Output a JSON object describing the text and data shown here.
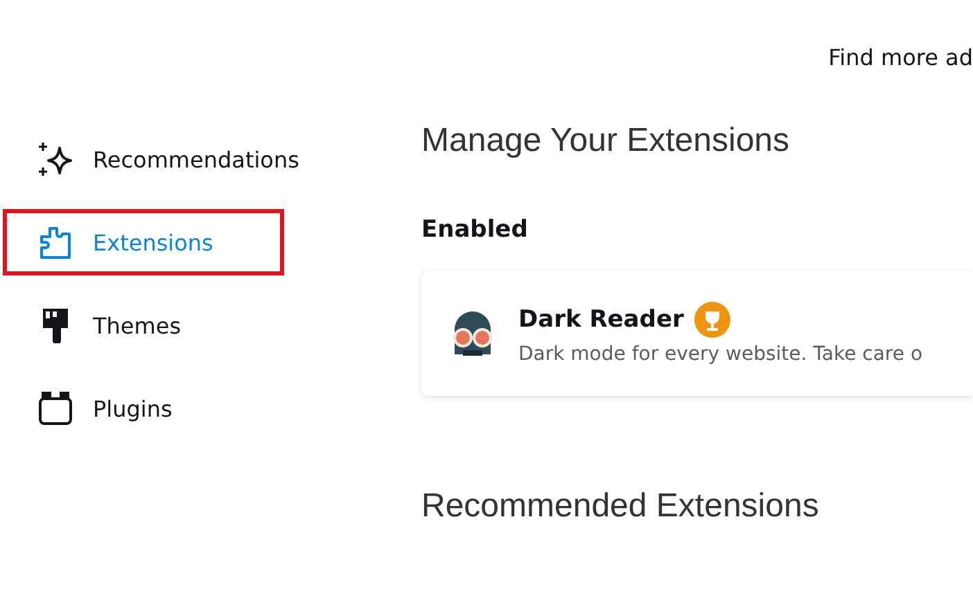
{
  "header": {
    "link": "Find more ad"
  },
  "sidebar": {
    "items": [
      {
        "kind": "recommendations",
        "label": "Recommendations",
        "selected": false,
        "highlighted": false
      },
      {
        "kind": "extensions",
        "label": "Extensions",
        "selected": true,
        "highlighted": true
      },
      {
        "kind": "themes",
        "label": "Themes",
        "selected": false,
        "highlighted": false
      },
      {
        "kind": "plugins",
        "label": "Plugins",
        "selected": false,
        "highlighted": false
      }
    ]
  },
  "main": {
    "title": "Manage Your Extensions",
    "section": "Enabled",
    "extensions": [
      {
        "name": "Dark Reader",
        "recommended": true,
        "description": "Dark mode for every website. Take care o"
      }
    ],
    "recommended_title": "Recommended Extensions"
  }
}
